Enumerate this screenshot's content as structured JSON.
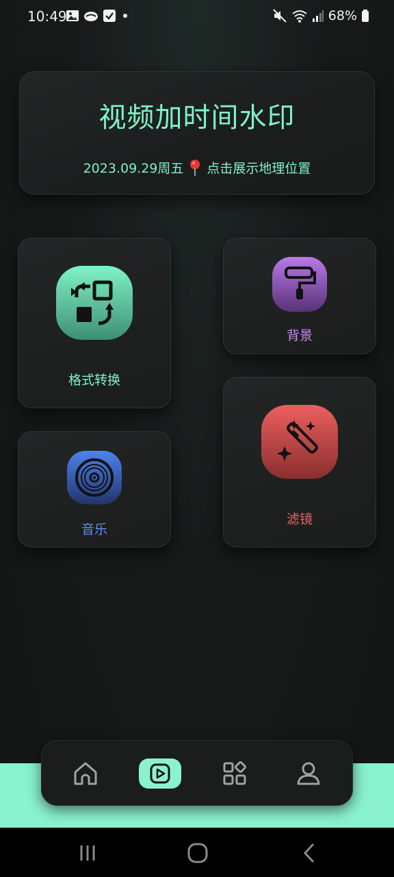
{
  "status_bar": {
    "time": "10:49",
    "battery": "68%"
  },
  "header": {
    "title": "视频加时间水印",
    "date": "2023.09.29周五",
    "location_label": "点击展示地理位置"
  },
  "features": {
    "format_convert": {
      "label": "格式转换",
      "icon": "format-convert-icon",
      "color": "#7ff2c8"
    },
    "background": {
      "label": "背景",
      "icon": "paint-roller-icon",
      "color": "#c98af2"
    },
    "music": {
      "label": "音乐",
      "icon": "vinyl-disc-icon",
      "color": "#5f8ff2"
    },
    "filter": {
      "label": "滤镜",
      "icon": "magic-wand-icon",
      "color": "#f06262"
    }
  },
  "bottom_nav": {
    "items": [
      {
        "name": "home",
        "icon": "home-icon",
        "active": false
      },
      {
        "name": "video",
        "icon": "play-icon",
        "active": true
      },
      {
        "name": "apps",
        "icon": "grid-icon",
        "active": false
      },
      {
        "name": "profile",
        "icon": "user-icon",
        "active": false
      }
    ],
    "accent": "#8af2cf"
  }
}
